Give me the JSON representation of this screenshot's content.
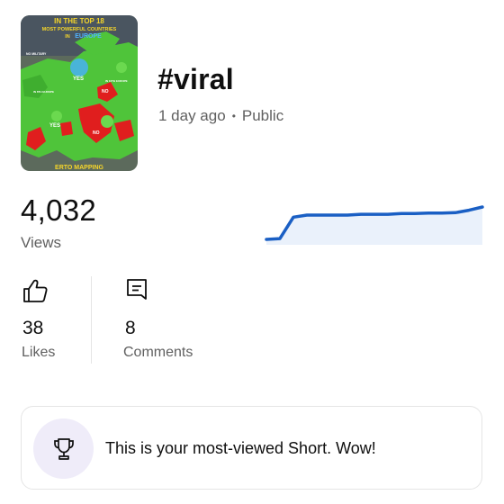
{
  "video": {
    "title": "#viral",
    "age": "1 day ago",
    "separator": "•",
    "visibility": "Public",
    "thumbnail": {
      "heading_line1": "IN THE TOP 18",
      "heading_line2": "MOST POWERFUL COUNTRIES",
      "heading_line3": "IN",
      "heading_line4": "EUROPE",
      "caption": "ERTO MAPPING",
      "labels": [
        "NO MILITARY",
        "YES",
        "IN 10TH EUROPE",
        "NO",
        "YES",
        "NO",
        "IN 8TH EUROPE"
      ]
    }
  },
  "views": {
    "count": "4,032",
    "label": "Views"
  },
  "sparkline": {
    "line_color": "#1a5fc4",
    "fill_color": "#eaf1fb",
    "points": [
      0.0,
      0.02,
      0.55,
      0.6,
      0.6,
      0.6,
      0.6,
      0.62,
      0.62,
      0.62,
      0.64,
      0.64,
      0.65,
      0.65,
      0.66,
      0.72,
      0.8
    ]
  },
  "stats": {
    "likes": {
      "value": "38",
      "label": "Likes",
      "icon": "thumbs-up-icon"
    },
    "comments": {
      "value": "8",
      "label": "Comments",
      "icon": "comment-icon"
    }
  },
  "highlight": {
    "message": "This is your most-viewed Short. Wow!",
    "icon": "trophy-icon",
    "badge_color": "#efecf9"
  }
}
